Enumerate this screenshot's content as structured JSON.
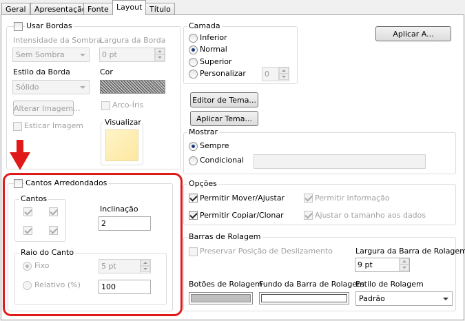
{
  "tabs": [
    "Geral",
    "Apresentação",
    "Fonte",
    "Layout",
    "Título"
  ],
  "borders": {
    "use_borders_label": "Usar Bordas",
    "shadow_intensity_label": "Intensidade da Sombra",
    "shadow_intensity_value": "Sem Sombra",
    "border_width_label": "Largura da Borda",
    "border_width_value": "0 pt",
    "border_style_label": "Estilo da Borda",
    "border_style_value": "Sólido",
    "color_label": "Cor",
    "change_image_label": "Alterar Imagem...",
    "rainbow_label": "Arco-Íris",
    "stretch_image_label": "Esticar Imagem",
    "preview_label": "Visualizar"
  },
  "rounded": {
    "rounded_corners_label": "Cantos Arredondados",
    "corners_label": "Cantos",
    "inclination_label": "Inclinação",
    "inclination_value": "2",
    "radius_label": "Raio do Canto",
    "fixed_label": "Fixo",
    "fixed_value": "5 pt",
    "relative_label": "Relativo (%)",
    "relative_value": "100"
  },
  "layer": {
    "label": "Camada",
    "options": [
      "Inferior",
      "Normal",
      "Superior",
      "Personalizar"
    ],
    "selected": "Normal",
    "custom_value": "0"
  },
  "buttons": {
    "apply_to": "Aplicar A...",
    "theme_editor": "Editor de Tema...",
    "apply_theme": "Aplicar Tema..."
  },
  "show": {
    "label": "Mostrar",
    "always": "Sempre",
    "conditional": "Condicional"
  },
  "options": {
    "label": "Opções",
    "allow_move_resize": "Permitir Mover/Ajustar",
    "allow_info": "Permitir Informação",
    "allow_copy_clone": "Permitir Copiar/Clonar",
    "fit_data_size": "Ajustar o tamanho aos dados"
  },
  "scrollbars": {
    "label": "Barras de Rolagem",
    "preserve_position": "Preservar Posição de Deslizamento",
    "width_label": "Largura da Barra de Rolagem",
    "width_value": "9 pt",
    "buttons_label": "Botões de Rolagem",
    "background_label": "Fundo da Barra de Rolagem",
    "style_label": "Estilo de Rolagem",
    "style_value": "Padrão"
  },
  "colors": {
    "highlight_red": "#e01919",
    "radio_selected": "#1c3e78"
  }
}
